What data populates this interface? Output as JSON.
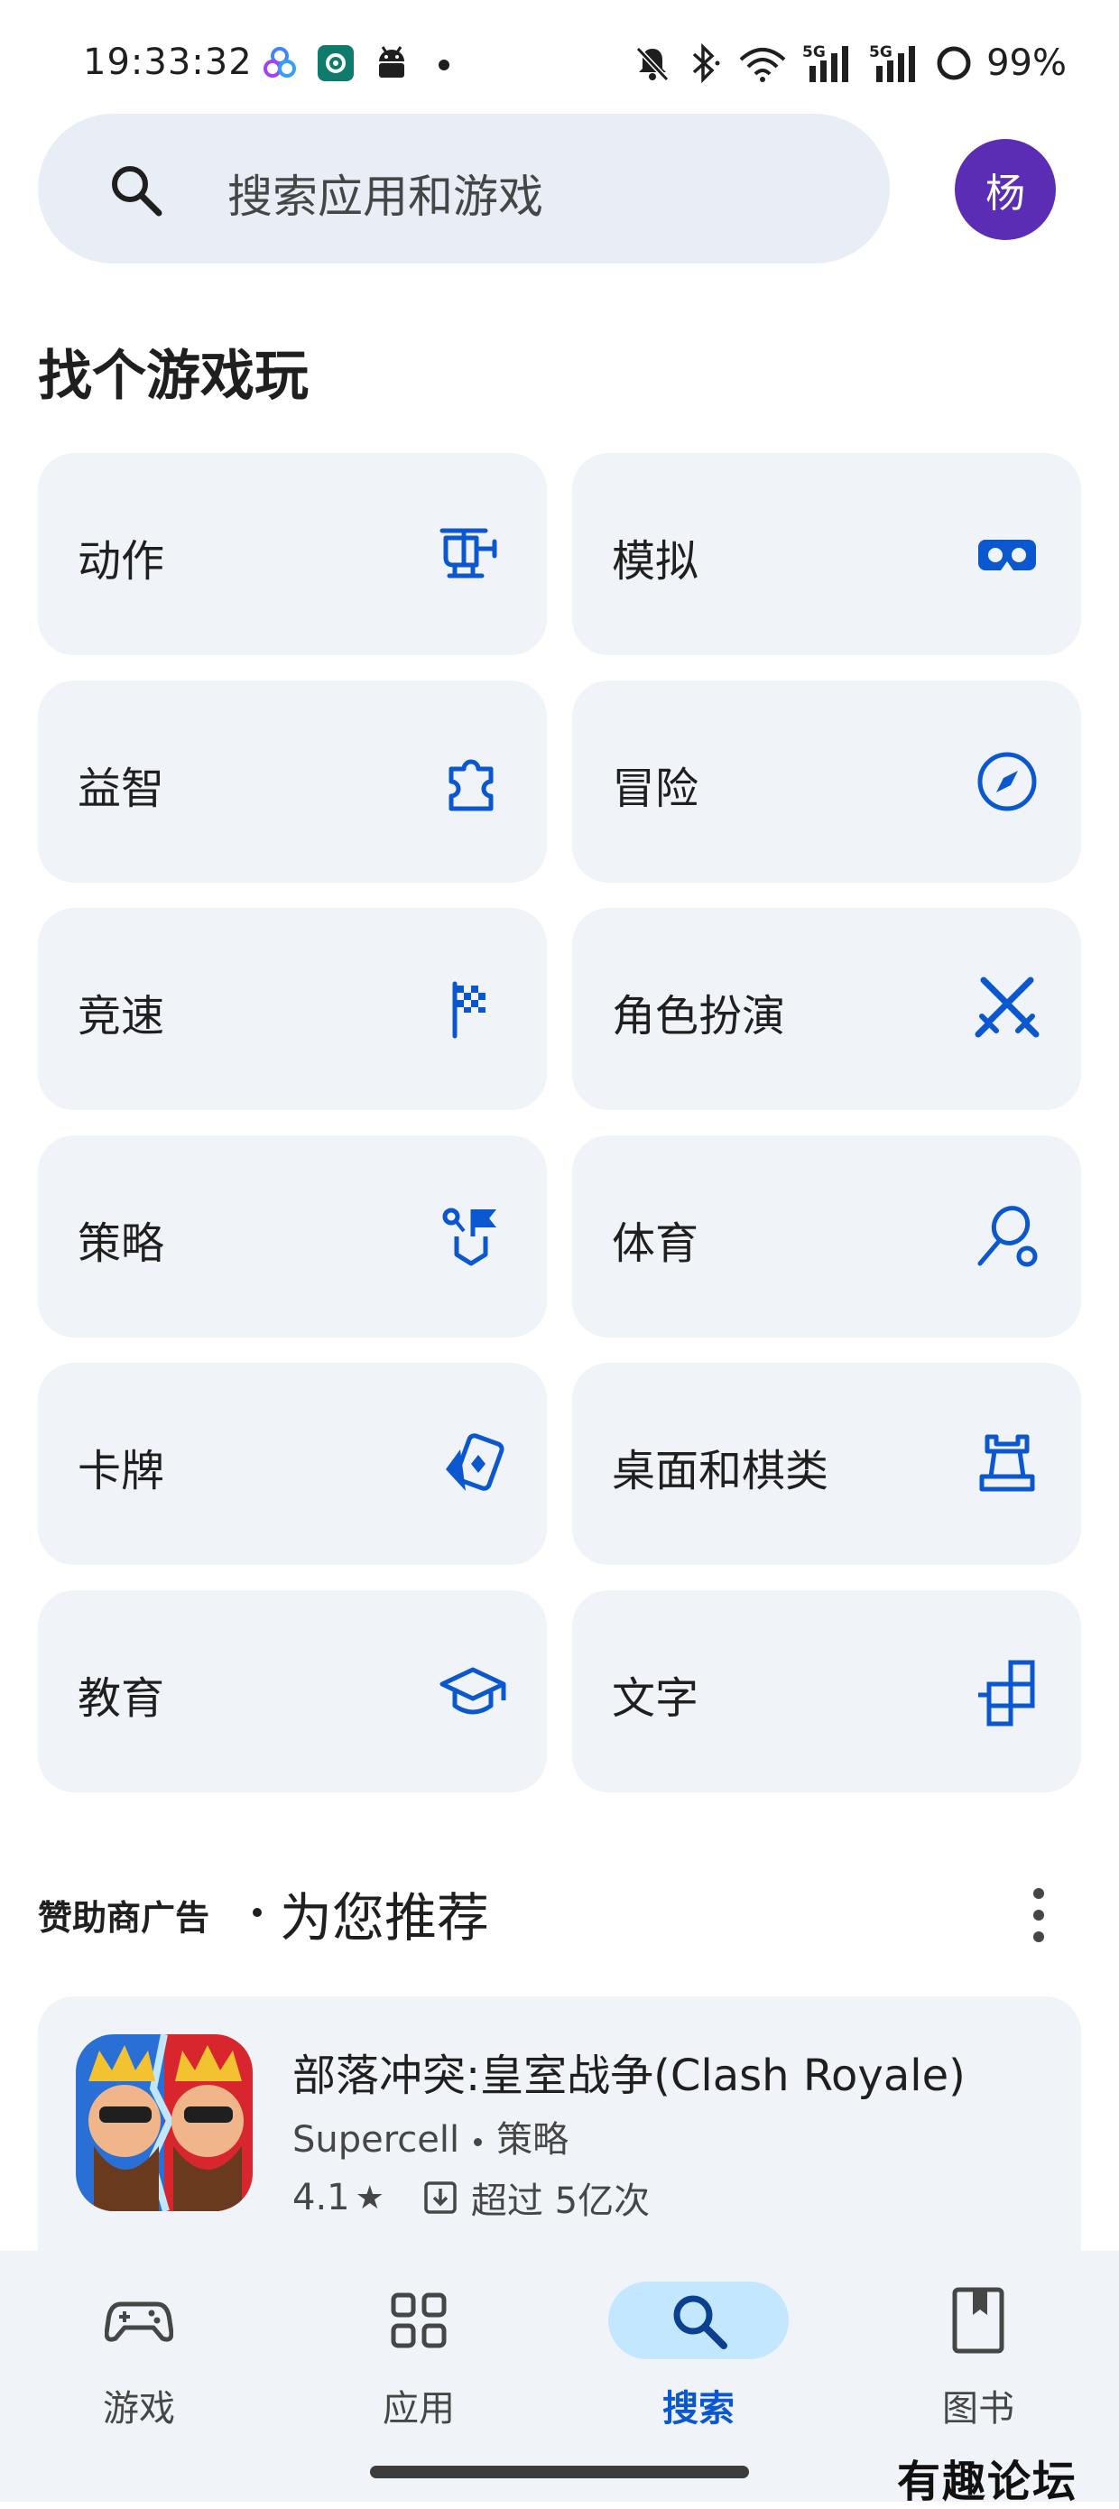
{
  "status_bar": {
    "time": "19:33:32",
    "battery": "99%",
    "notification_icons": [
      "photos-icon",
      "settings-app-icon",
      "android-icon"
    ],
    "system_icons": [
      "mute-bell-icon",
      "bluetooth-icon",
      "wifi-icon",
      "5g-signal-icon",
      "5g-signal-icon",
      "battery-ring-icon"
    ]
  },
  "search": {
    "placeholder": "搜索应用和游戏",
    "avatar_initial": "杨",
    "avatar_color": "#5b2db5"
  },
  "section": {
    "title": "找个游戏玩"
  },
  "categories": [
    {
      "label": "动作",
      "icon": "helicopter-icon"
    },
    {
      "label": "模拟",
      "icon": "vr-headset-icon"
    },
    {
      "label": "益智",
      "icon": "puzzle-piece-icon"
    },
    {
      "label": "冒险",
      "icon": "compass-icon"
    },
    {
      "label": "竞速",
      "icon": "checkered-flag-icon"
    },
    {
      "label": "角色扮演",
      "icon": "crossed-swords-icon"
    },
    {
      "label": "策略",
      "icon": "strategy-flag-icon"
    },
    {
      "label": "体育",
      "icon": "racket-ball-icon"
    },
    {
      "label": "卡牌",
      "icon": "playing-cards-icon"
    },
    {
      "label": "桌面和棋类",
      "icon": "chess-rook-icon"
    },
    {
      "label": "教育",
      "icon": "graduation-cap-icon"
    },
    {
      "label": "文字",
      "icon": "letter-tiles-icon"
    }
  ],
  "recommendations": {
    "ad_label": "赞助商广告",
    "title": "为您推荐",
    "app": {
      "name": "部落冲突:皇室战争(Clash Royale)",
      "developer": "Supercell",
      "genre": "策略",
      "rating": "4.1",
      "downloads": "超过 5亿次"
    }
  },
  "nav": [
    {
      "label": "游戏",
      "icon": "gamepad-icon",
      "active": false
    },
    {
      "label": "应用",
      "icon": "apps-grid-icon",
      "active": false
    },
    {
      "label": "搜索",
      "icon": "search-icon",
      "active": true
    },
    {
      "label": "图书",
      "icon": "book-bookmark-icon",
      "active": false
    }
  ],
  "watermark": "有趣论坛",
  "colors": {
    "accent": "#0b57d0",
    "tile_background": "#f0f4f9",
    "search_background": "#e9eef6",
    "nav_active_pill": "#c2e7ff"
  }
}
